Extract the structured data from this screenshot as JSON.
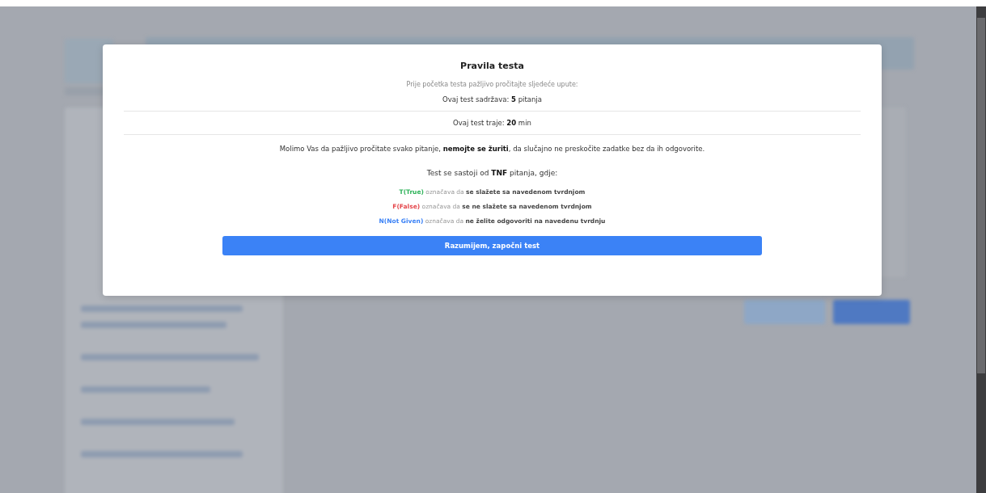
{
  "modal": {
    "title": "Pravila testa",
    "subtitle": "Prije početka testa pažljivo pročitajte sljedeće upute:",
    "facts": [
      "Ovaj test sadržava: **5** pitanja",
      "Ovaj test traje: **20** min"
    ],
    "warning": "Molimo Vas da pažljivo pročitate svako pitanje, **nemojte se žuriti**, da slučajno ne preskočite zadatke bez da ih odgovorite.",
    "intro": "Test se sastoji od **TNF** pitanja, gdje:",
    "legend": [
      {
        "term": "T(True)",
        "color": "#2fb35a",
        "connector": "označava da",
        "meaning": "se slažete sa navedenom tvrdnjom"
      },
      {
        "term": "F(False)",
        "color": "#e5484d",
        "connector": "označava da",
        "meaning": "se ne slažete sa navedenom tvrdnjom"
      },
      {
        "term": "N(Not Given)",
        "color": "#3b82f6",
        "connector": "označava da",
        "meaning": "ne želite odgovoriti na navedenu tvrdnju"
      }
    ],
    "button": "Razumijem, započni test"
  }
}
